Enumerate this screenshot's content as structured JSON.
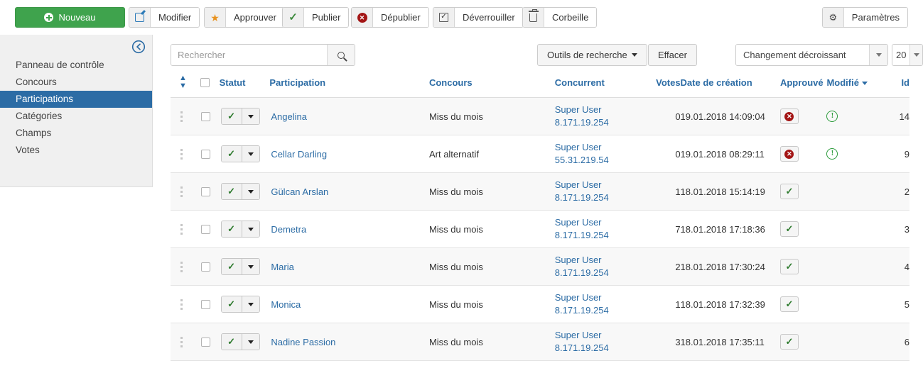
{
  "toolbar": {
    "new_label": "Nouveau",
    "buttons": [
      {
        "label": "Modifier",
        "icon": "edit-icon"
      },
      {
        "label": "Approuver",
        "icon": "star-icon"
      },
      {
        "label": "Publier",
        "icon": "check-icon"
      },
      {
        "label": "Dépublier",
        "icon": "x-circle-icon"
      },
      {
        "label": "Déverrouiller",
        "icon": "checkbox-icon"
      },
      {
        "label": "Corbeille",
        "icon": "trash-icon"
      }
    ],
    "settings_label": "Paramètres",
    "settings_icon": "gear-icon"
  },
  "sidebar": {
    "collapse_icon": "arrow-left-circle-icon",
    "items": [
      {
        "label": "Panneau de contrôle",
        "active": false
      },
      {
        "label": "Concours",
        "active": false
      },
      {
        "label": "Participations",
        "active": true
      },
      {
        "label": "Catégories",
        "active": false
      },
      {
        "label": "Champs",
        "active": false
      },
      {
        "label": "Votes",
        "active": false
      }
    ]
  },
  "filterbar": {
    "search_placeholder": "Rechercher",
    "search_value": "",
    "search_icon": "search-icon",
    "search_tools_label": "Outils de recherche",
    "clear_label": "Effacer",
    "sort_value": "Changement décroissant",
    "limit_value": "20"
  },
  "table": {
    "headers": {
      "ordering": "",
      "checkall": "",
      "status": "Statut",
      "participation": "Participation",
      "contest": "Concours",
      "competitor": "Concurrent",
      "votes": "Votes",
      "created": "Date de création",
      "approved": "Approuvé",
      "modified": "Modifié",
      "id": "Id"
    },
    "sorted_column": "modified",
    "rows": [
      {
        "participation": "Angelina",
        "contest": "Miss du mois",
        "competitor_name": "Super User",
        "competitor_ip": "8.171.19.254",
        "votes": "0",
        "created": "19.01.2018 14:09:04",
        "approved": "no",
        "modified": "warning",
        "id": "14"
      },
      {
        "participation": "Cellar Darling",
        "contest": "Art alternatif",
        "competitor_name": "Super User",
        "competitor_ip": "55.31.219.54",
        "votes": "0",
        "created": "19.01.2018 08:29:11",
        "approved": "no",
        "modified": "warning",
        "id": "9"
      },
      {
        "participation": "Gülcan Arslan",
        "contest": "Miss du mois",
        "competitor_name": "Super User",
        "competitor_ip": "8.171.19.254",
        "votes": "1",
        "created": "18.01.2018 15:14:19",
        "approved": "yes",
        "modified": "",
        "id": "2"
      },
      {
        "participation": "Demetra",
        "contest": "Miss du mois",
        "competitor_name": "Super User",
        "competitor_ip": "8.171.19.254",
        "votes": "7",
        "created": "18.01.2018 17:18:36",
        "approved": "yes",
        "modified": "",
        "id": "3"
      },
      {
        "participation": "Maria",
        "contest": "Miss du mois",
        "competitor_name": "Super User",
        "competitor_ip": "8.171.19.254",
        "votes": "2",
        "created": "18.01.2018 17:30:24",
        "approved": "yes",
        "modified": "",
        "id": "4"
      },
      {
        "participation": "Monica",
        "contest": "Miss du mois",
        "competitor_name": "Super User",
        "competitor_ip": "8.171.19.254",
        "votes": "1",
        "created": "18.01.2018 17:32:39",
        "approved": "yes",
        "modified": "",
        "id": "5"
      },
      {
        "participation": "Nadine Passion",
        "contest": "Miss du mois",
        "competitor_name": "Super User",
        "competitor_ip": "8.171.19.254",
        "votes": "3",
        "created": "18.01.2018 17:35:11",
        "approved": "yes",
        "modified": "",
        "id": "6"
      }
    ]
  },
  "colors": {
    "primary_green": "#3fa34d",
    "link_blue": "#2c6ca5",
    "active_blue": "#2c6ca5",
    "danger_red": "#a31515",
    "ok_green": "#2d7a2d",
    "warn_green": "#2d9c3c"
  }
}
